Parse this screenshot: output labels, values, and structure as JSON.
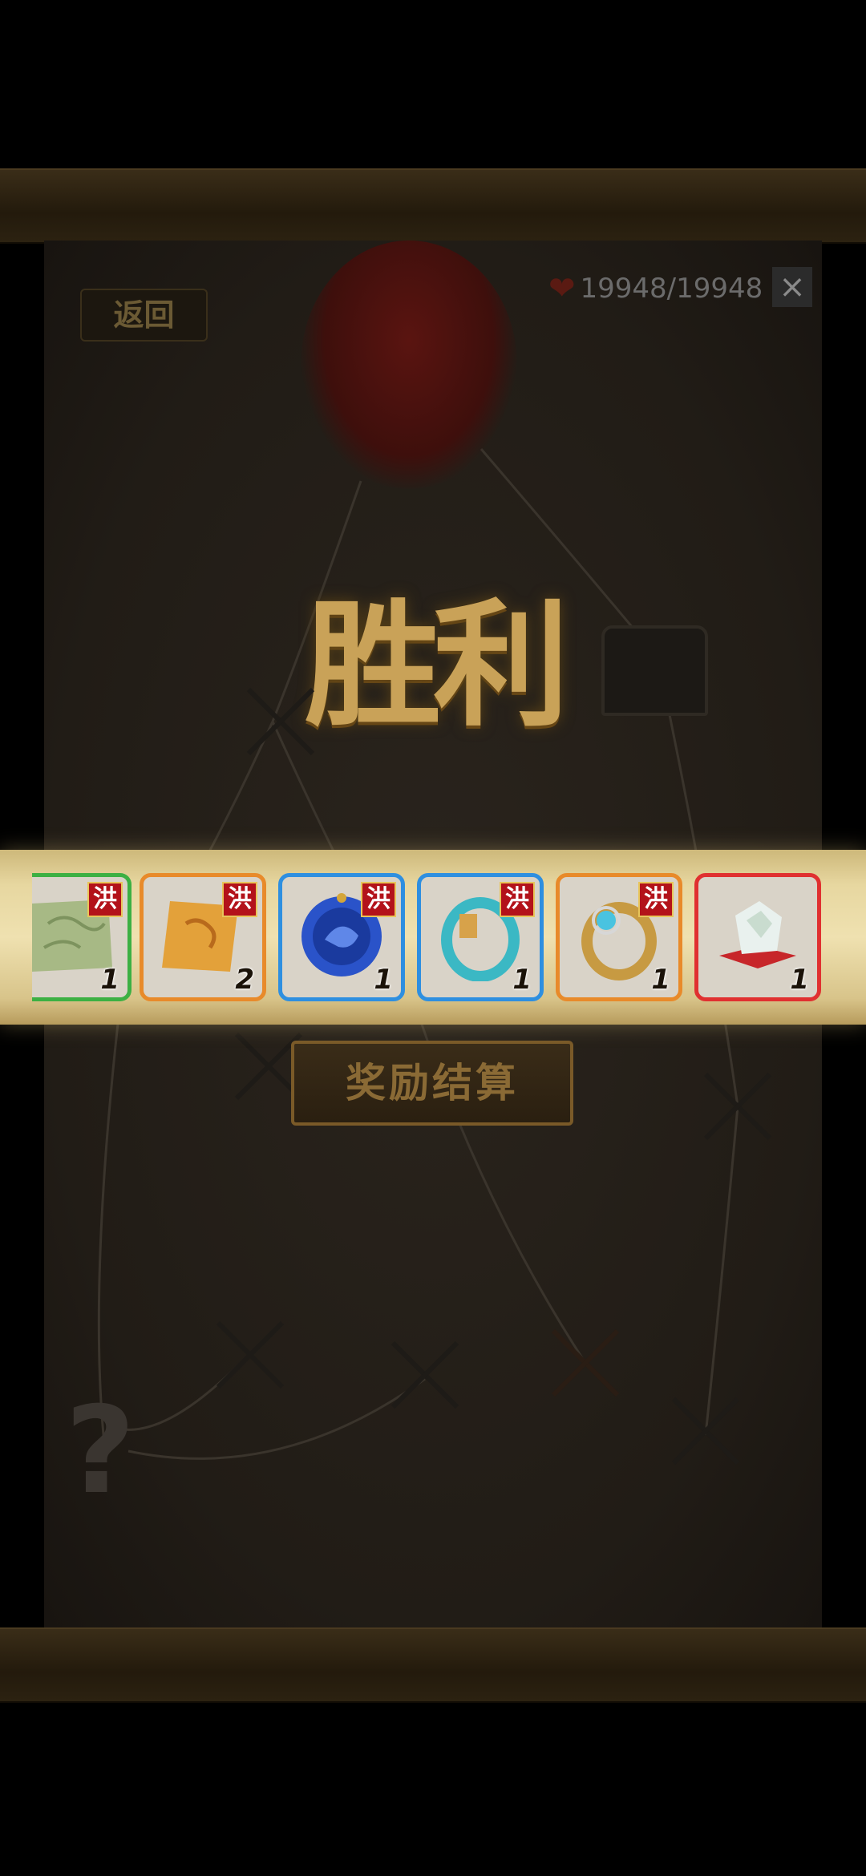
{
  "header": {
    "back_label": "返回",
    "hp_icon": "heart-icon",
    "hp_value": "19948/19948",
    "close_label": "×"
  },
  "map": {
    "victory_text": "胜利",
    "unknown_node_label": "?"
  },
  "rewards": {
    "items": [
      {
        "name": "green-scroll",
        "badge": "洪",
        "count": "1",
        "rarity_color": "#3cb043"
      },
      {
        "name": "orange-scroll",
        "badge": "洪",
        "count": "2",
        "rarity_color": "#e88a2a"
      },
      {
        "name": "blue-orb",
        "badge": "洪",
        "count": "1",
        "rarity_color": "#2e8fe0"
      },
      {
        "name": "jade-ring",
        "badge": "洪",
        "count": "1",
        "rarity_color": "#2e8fe0"
      },
      {
        "name": "gold-ring",
        "badge": "洪",
        "count": "1",
        "rarity_color": "#e88a2a"
      },
      {
        "name": "crystal-stone",
        "badge": "",
        "count": "1",
        "rarity_color": "#e03030"
      }
    ]
  },
  "actions": {
    "settle_label": "奖励结算"
  }
}
